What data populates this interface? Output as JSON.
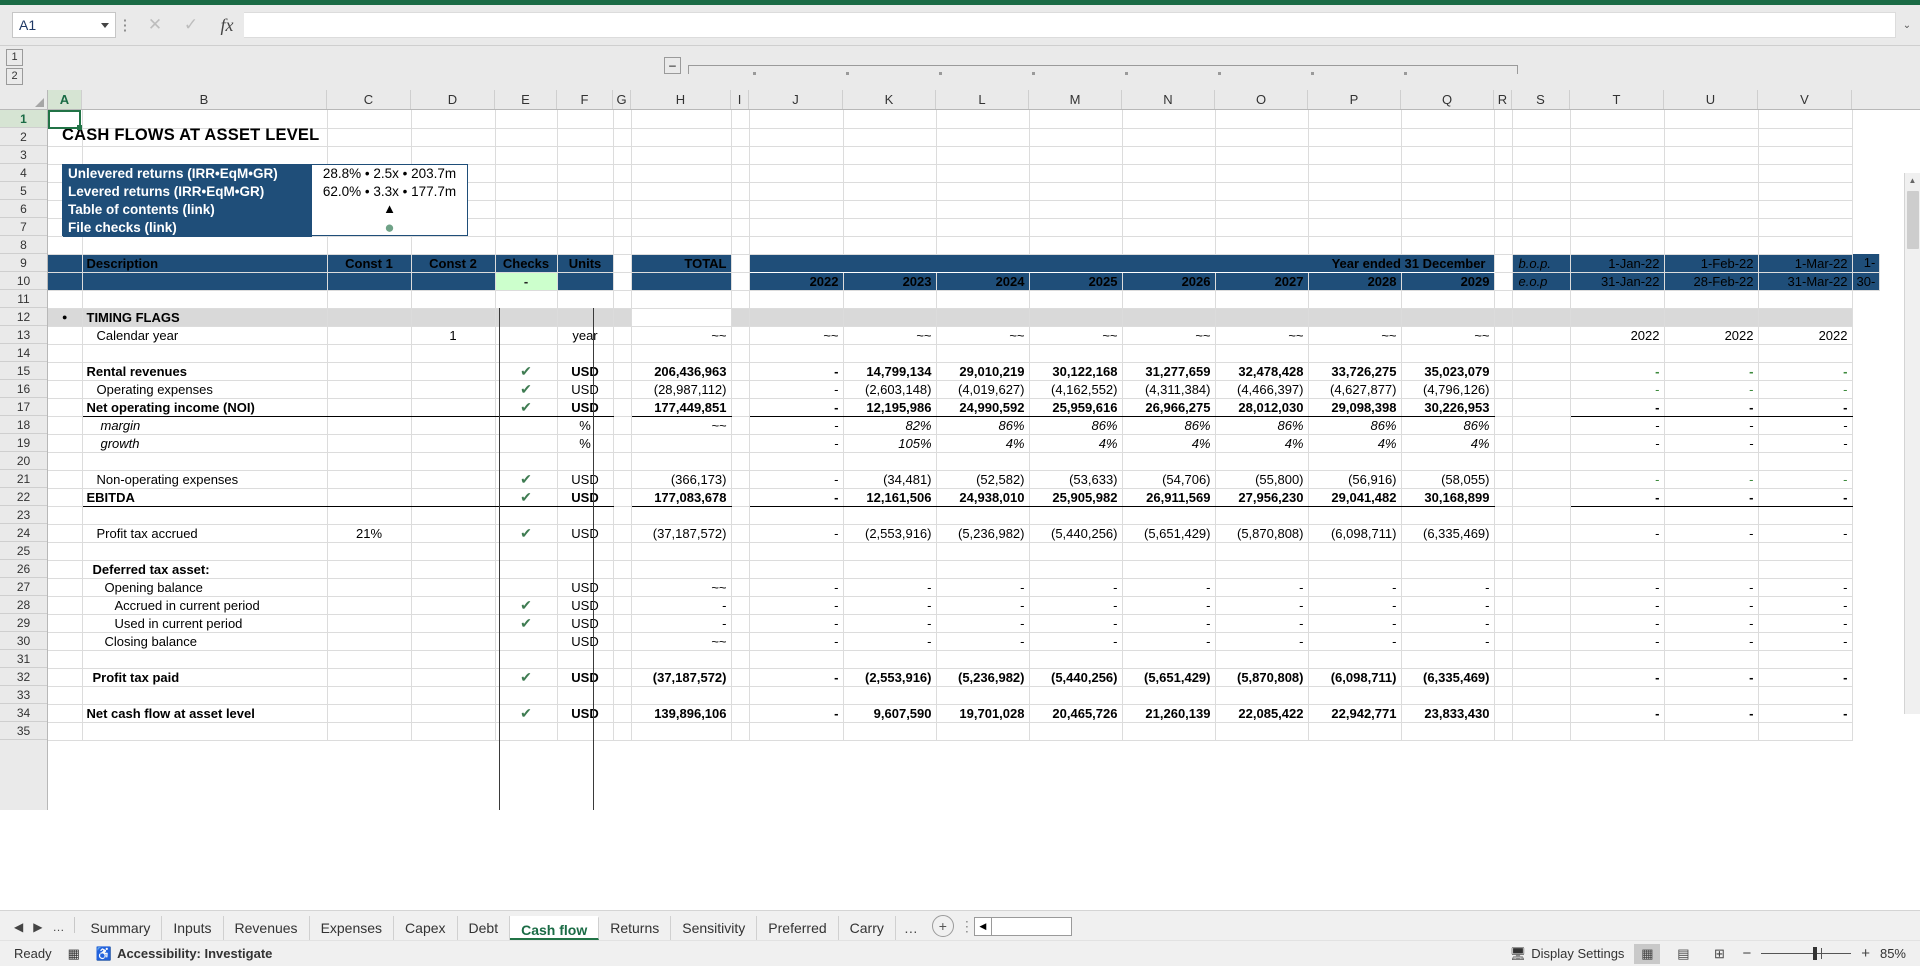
{
  "app": {
    "name_box_value": "A1",
    "formula_value": "",
    "icons": {
      "cancel": "✕",
      "confirm": "✓",
      "fx": "fx"
    }
  },
  "outline": {
    "level1": "1",
    "level2": "2",
    "collapse": "–"
  },
  "columns": [
    "A",
    "B",
    "C",
    "D",
    "E",
    "F",
    "G",
    "H",
    "I",
    "J",
    "K",
    "L",
    "M",
    "N",
    "O",
    "P",
    "Q",
    "R",
    "S",
    "T",
    "U",
    "V"
  ],
  "rows": [
    "1",
    "2",
    "3",
    "4",
    "5",
    "6",
    "7",
    "8",
    "9",
    "10",
    "11",
    "12",
    "13",
    "14",
    "15",
    "16",
    "17",
    "18",
    "19",
    "20",
    "21",
    "22",
    "23",
    "24",
    "25",
    "26",
    "27",
    "28",
    "29",
    "30",
    "31",
    "32",
    "33",
    "34",
    "35"
  ],
  "sheet": {
    "title": "CASH FLOWS AT ASSET LEVEL",
    "returns_box": [
      {
        "label": "Unlevered returns (IRR•EqM•GR)",
        "value": "28.8% • 2.5x • 203.7m"
      },
      {
        "label": "Levered returns (IRR•EqM•GR)",
        "value": "62.0% • 3.3x • 177.7m"
      },
      {
        "label": "Table of contents (link)",
        "value": "▲"
      },
      {
        "label": "File checks (link)",
        "value": "●"
      }
    ],
    "header": {
      "description": "Description",
      "const1": "Const 1",
      "const2": "Const 2",
      "checks": "Checks",
      "checks_value": "-",
      "units": "Units",
      "total": "TOTAL",
      "year_band": "Year ended 31 December",
      "years": [
        "2022",
        "2023",
        "2024",
        "2025",
        "2026",
        "2027",
        "2028",
        "2029"
      ],
      "bop_label": "b.o.p.",
      "eop_label": "e.o.p",
      "bop_dates": [
        "1-Jan-22",
        "1-Feb-22",
        "1-Mar-22",
        "1-"
      ],
      "eop_dates": [
        "31-Jan-22",
        "28-Feb-22",
        "31-Mar-22",
        "30-"
      ]
    },
    "lines": [
      {
        "row": 12,
        "label": "TIMING FLAGS",
        "style": "section",
        "bullet": "●",
        "const1": "",
        "const2": "",
        "check": "",
        "units": "",
        "total": "",
        "years": [],
        "months": []
      },
      {
        "row": 13,
        "label": "Calendar year",
        "style": "indent1",
        "const1": "",
        "const2": "1",
        "check": "",
        "units": "year",
        "total": "~~",
        "years": [
          "~~",
          "~~",
          "~~",
          "~~",
          "~~",
          "~~",
          "~~",
          "~~"
        ],
        "months": [
          "2022",
          "2022",
          "2022"
        ]
      },
      {
        "row": 14,
        "label": "",
        "style": "blank",
        "const1": "",
        "const2": "",
        "check": "",
        "units": "",
        "total": "",
        "years": [],
        "months": []
      },
      {
        "row": 15,
        "label": "Rental revenues",
        "style": "bold",
        "const1": "",
        "const2": "",
        "check": "✔",
        "units": "USD",
        "total": "206,436,963",
        "years": [
          "-",
          "14,799,134",
          "29,010,219",
          "30,122,168",
          "31,277,659",
          "32,478,428",
          "33,726,275",
          "35,023,079"
        ],
        "months": [
          "-",
          "-",
          "-"
        ],
        "months_green": true
      },
      {
        "row": 16,
        "label": "Operating expenses",
        "style": "indent1",
        "const1": "",
        "const2": "",
        "check": "✔",
        "units": "USD",
        "total": "(28,987,112)",
        "years": [
          "-",
          "(2,603,148)",
          "(4,019,627)",
          "(4,162,552)",
          "(4,311,384)",
          "(4,466,397)",
          "(4,627,877)",
          "(4,796,126)"
        ],
        "months": [
          "-",
          "-",
          "-"
        ],
        "months_green": true
      },
      {
        "row": 17,
        "label": "Net operating income (NOI)",
        "style": "bold-underline",
        "const1": "",
        "const2": "",
        "check": "✔",
        "units": "USD",
        "total": "177,449,851",
        "years": [
          "-",
          "12,195,986",
          "24,990,592",
          "25,959,616",
          "26,966,275",
          "28,012,030",
          "29,098,398",
          "30,226,953"
        ],
        "months": [
          "-",
          "-",
          "-"
        ]
      },
      {
        "row": 18,
        "label": "margin",
        "style": "italic-indent",
        "const1": "",
        "const2": "",
        "check": "",
        "units": "%",
        "total": "~~",
        "years": [
          "-",
          "82%",
          "86%",
          "86%",
          "86%",
          "86%",
          "86%",
          "86%"
        ],
        "months": [
          "-",
          "-",
          "-"
        ]
      },
      {
        "row": 19,
        "label": "growth",
        "style": "italic-indent",
        "const1": "",
        "const2": "",
        "check": "",
        "units": "%",
        "total": "",
        "years": [
          "-",
          "105%",
          "4%",
          "4%",
          "4%",
          "4%",
          "4%",
          "4%"
        ],
        "months": [
          "-",
          "-",
          "-"
        ]
      },
      {
        "row": 20,
        "label": "",
        "style": "blank",
        "const1": "",
        "const2": "",
        "check": "",
        "units": "",
        "total": "",
        "years": [],
        "months": []
      },
      {
        "row": 21,
        "label": "Non-operating expenses",
        "style": "indent1",
        "const1": "",
        "const2": "",
        "check": "✔",
        "units": "USD",
        "total": "(366,173)",
        "years": [
          "-",
          "(34,481)",
          "(52,582)",
          "(53,633)",
          "(54,706)",
          "(55,800)",
          "(56,916)",
          "(58,055)"
        ],
        "months": [
          "-",
          "-",
          "-"
        ],
        "months_green": true
      },
      {
        "row": 22,
        "label": "EBITDA",
        "style": "bold-underline",
        "const1": "",
        "const2": "",
        "check": "✔",
        "units": "USD",
        "total": "177,083,678",
        "years": [
          "-",
          "12,161,506",
          "24,938,010",
          "25,905,982",
          "26,911,569",
          "27,956,230",
          "29,041,482",
          "30,168,899"
        ],
        "months": [
          "-",
          "-",
          "-"
        ]
      },
      {
        "row": 23,
        "label": "",
        "style": "blank",
        "const1": "",
        "const2": "",
        "check": "",
        "units": "",
        "total": "",
        "years": [],
        "months": []
      },
      {
        "row": 24,
        "label": "Profit tax accrued",
        "style": "indent1",
        "const1": "21%",
        "const2": "",
        "check": "✔",
        "units": "USD",
        "total": "(37,187,572)",
        "years": [
          "-",
          "(2,553,916)",
          "(5,236,982)",
          "(5,440,256)",
          "(5,651,429)",
          "(5,870,808)",
          "(6,098,711)",
          "(6,335,469)"
        ],
        "months": [
          "-",
          "-",
          "-"
        ]
      },
      {
        "row": 25,
        "label": "",
        "style": "blank",
        "const1": "",
        "const2": "",
        "check": "",
        "units": "",
        "total": "",
        "years": [],
        "months": []
      },
      {
        "row": 26,
        "label": "Deferred tax asset:",
        "style": "bold-indent",
        "const1": "",
        "const2": "",
        "check": "",
        "units": "",
        "total": "",
        "years": [],
        "months": []
      },
      {
        "row": 27,
        "label": "Opening balance",
        "style": "indent2",
        "const1": "",
        "const2": "",
        "check": "",
        "units": "USD",
        "total": "~~",
        "years": [
          "-",
          "-",
          "-",
          "-",
          "-",
          "-",
          "-",
          "-"
        ],
        "months": [
          "-",
          "-",
          "-"
        ]
      },
      {
        "row": 28,
        "label": "Accrued in current period",
        "style": "indent3",
        "const1": "",
        "const2": "",
        "check": "✔",
        "units": "USD",
        "total": "-",
        "years": [
          "-",
          "-",
          "-",
          "-",
          "-",
          "-",
          "-",
          "-"
        ],
        "months": [
          "-",
          "-",
          "-"
        ]
      },
      {
        "row": 29,
        "label": "Used in current period",
        "style": "indent3",
        "const1": "",
        "const2": "",
        "check": "✔",
        "units": "USD",
        "total": "-",
        "years": [
          "-",
          "-",
          "-",
          "-",
          "-",
          "-",
          "-",
          "-"
        ],
        "months": [
          "-",
          "-",
          "-"
        ]
      },
      {
        "row": 30,
        "label": "Closing balance",
        "style": "indent2",
        "const1": "",
        "const2": "",
        "check": "",
        "units": "USD",
        "total": "~~",
        "years": [
          "-",
          "-",
          "-",
          "-",
          "-",
          "-",
          "-",
          "-"
        ],
        "months": [
          "-",
          "-",
          "-"
        ]
      },
      {
        "row": 31,
        "label": "",
        "style": "blank",
        "const1": "",
        "const2": "",
        "check": "",
        "units": "",
        "total": "",
        "years": [],
        "months": []
      },
      {
        "row": 32,
        "label": "Profit tax paid",
        "style": "bold-indent",
        "const1": "",
        "const2": "",
        "check": "✔",
        "units": "USD",
        "total": "(37,187,572)",
        "years": [
          "-",
          "(2,553,916)",
          "(5,236,982)",
          "(5,440,256)",
          "(5,651,429)",
          "(5,870,808)",
          "(6,098,711)",
          "(6,335,469)"
        ],
        "months": [
          "-",
          "-",
          "-"
        ]
      },
      {
        "row": 33,
        "label": "",
        "style": "blank",
        "const1": "",
        "const2": "",
        "check": "",
        "units": "",
        "total": "",
        "years": [],
        "months": []
      },
      {
        "row": 34,
        "label": "Net cash flow at asset level",
        "style": "bold-topline",
        "const1": "",
        "const2": "",
        "check": "✔",
        "units": "USD",
        "total": "139,896,106",
        "years": [
          "-",
          "9,607,590",
          "19,701,028",
          "20,465,726",
          "21,260,139",
          "22,085,422",
          "22,942,771",
          "23,833,430"
        ],
        "months": [
          "-",
          "-",
          "-"
        ]
      }
    ]
  },
  "tabs": {
    "overflow_left": "…",
    "items": [
      "Summary",
      "Inputs",
      "Revenues",
      "Expenses",
      "Capex",
      "Debt",
      "Cash flow",
      "Returns",
      "Sensitivity",
      "Preferred",
      "Carry"
    ],
    "active": "Cash flow",
    "overflow_right": "…",
    "add_label": "+"
  },
  "status": {
    "mode": "Ready",
    "accessibility": "Accessibility: Investigate",
    "display_settings": "Display Settings",
    "zoom": "85%"
  },
  "colors": {
    "navy": "#1f4e79",
    "green_accent": "#217346",
    "check_green": "#3f7c52",
    "grey_section": "#d9d9d9",
    "light_green_check": "#ccffcc"
  }
}
